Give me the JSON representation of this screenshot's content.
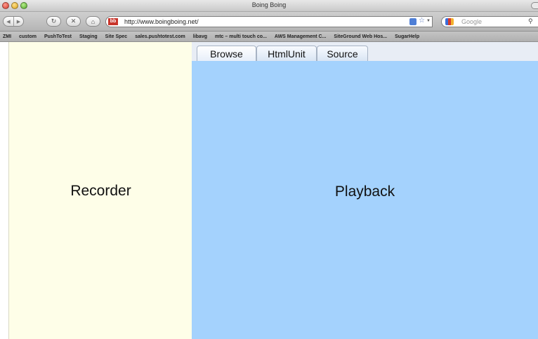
{
  "window": {
    "title": "Boing Boing"
  },
  "toolbar": {
    "url": "http://www.boingboing.net/",
    "search_placeholder": "Google",
    "favicon_text": "bb"
  },
  "bookmarks": [
    "ZMI",
    "custom",
    "PushToTest",
    "Staging",
    "Site Spec",
    "sales.pushtotest.com",
    "libavg",
    "mtc – multi touch co...",
    "AWS Management C...",
    "SiteGround Web Hos...",
    "SugarHelp"
  ],
  "recorder": {
    "label": "Recorder"
  },
  "playback": {
    "label": "Playback",
    "tabs": [
      {
        "label": "Browse"
      },
      {
        "label": "HtmlUnit"
      },
      {
        "label": "Source"
      }
    ]
  },
  "colors": {
    "recorder_bg": "#fefee8",
    "playback_bg": "#a4d2fd"
  }
}
